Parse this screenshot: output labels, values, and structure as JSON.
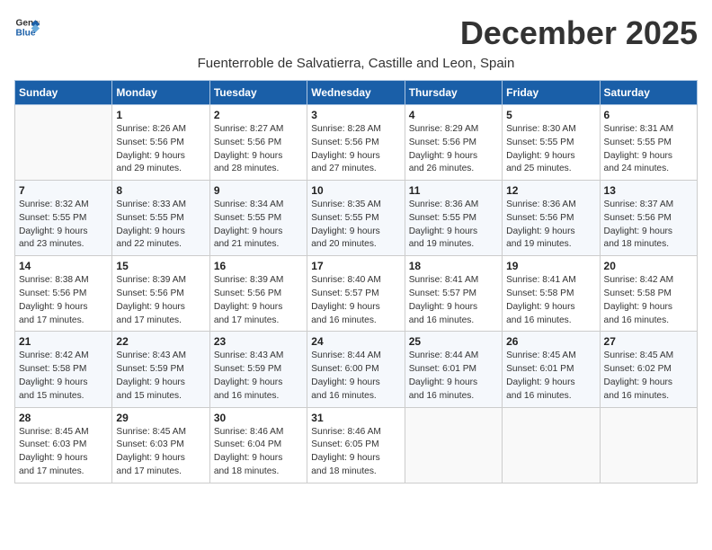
{
  "header": {
    "logo_line1": "General",
    "logo_line2": "Blue",
    "month_title": "December 2025",
    "location": "Fuenterroble de Salvatierra, Castille and Leon, Spain"
  },
  "weekdays": [
    "Sunday",
    "Monday",
    "Tuesday",
    "Wednesday",
    "Thursday",
    "Friday",
    "Saturday"
  ],
  "weeks": [
    [
      {
        "day": "",
        "info": ""
      },
      {
        "day": "1",
        "info": "Sunrise: 8:26 AM\nSunset: 5:56 PM\nDaylight: 9 hours\nand 29 minutes."
      },
      {
        "day": "2",
        "info": "Sunrise: 8:27 AM\nSunset: 5:56 PM\nDaylight: 9 hours\nand 28 minutes."
      },
      {
        "day": "3",
        "info": "Sunrise: 8:28 AM\nSunset: 5:56 PM\nDaylight: 9 hours\nand 27 minutes."
      },
      {
        "day": "4",
        "info": "Sunrise: 8:29 AM\nSunset: 5:56 PM\nDaylight: 9 hours\nand 26 minutes."
      },
      {
        "day": "5",
        "info": "Sunrise: 8:30 AM\nSunset: 5:55 PM\nDaylight: 9 hours\nand 25 minutes."
      },
      {
        "day": "6",
        "info": "Sunrise: 8:31 AM\nSunset: 5:55 PM\nDaylight: 9 hours\nand 24 minutes."
      }
    ],
    [
      {
        "day": "7",
        "info": "Sunrise: 8:32 AM\nSunset: 5:55 PM\nDaylight: 9 hours\nand 23 minutes."
      },
      {
        "day": "8",
        "info": "Sunrise: 8:33 AM\nSunset: 5:55 PM\nDaylight: 9 hours\nand 22 minutes."
      },
      {
        "day": "9",
        "info": "Sunrise: 8:34 AM\nSunset: 5:55 PM\nDaylight: 9 hours\nand 21 minutes."
      },
      {
        "day": "10",
        "info": "Sunrise: 8:35 AM\nSunset: 5:55 PM\nDaylight: 9 hours\nand 20 minutes."
      },
      {
        "day": "11",
        "info": "Sunrise: 8:36 AM\nSunset: 5:55 PM\nDaylight: 9 hours\nand 19 minutes."
      },
      {
        "day": "12",
        "info": "Sunrise: 8:36 AM\nSunset: 5:56 PM\nDaylight: 9 hours\nand 19 minutes."
      },
      {
        "day": "13",
        "info": "Sunrise: 8:37 AM\nSunset: 5:56 PM\nDaylight: 9 hours\nand 18 minutes."
      }
    ],
    [
      {
        "day": "14",
        "info": "Sunrise: 8:38 AM\nSunset: 5:56 PM\nDaylight: 9 hours\nand 17 minutes."
      },
      {
        "day": "15",
        "info": "Sunrise: 8:39 AM\nSunset: 5:56 PM\nDaylight: 9 hours\nand 17 minutes."
      },
      {
        "day": "16",
        "info": "Sunrise: 8:39 AM\nSunset: 5:56 PM\nDaylight: 9 hours\nand 17 minutes."
      },
      {
        "day": "17",
        "info": "Sunrise: 8:40 AM\nSunset: 5:57 PM\nDaylight: 9 hours\nand 16 minutes."
      },
      {
        "day": "18",
        "info": "Sunrise: 8:41 AM\nSunset: 5:57 PM\nDaylight: 9 hours\nand 16 minutes."
      },
      {
        "day": "19",
        "info": "Sunrise: 8:41 AM\nSunset: 5:58 PM\nDaylight: 9 hours\nand 16 minutes."
      },
      {
        "day": "20",
        "info": "Sunrise: 8:42 AM\nSunset: 5:58 PM\nDaylight: 9 hours\nand 16 minutes."
      }
    ],
    [
      {
        "day": "21",
        "info": "Sunrise: 8:42 AM\nSunset: 5:58 PM\nDaylight: 9 hours\nand 15 minutes."
      },
      {
        "day": "22",
        "info": "Sunrise: 8:43 AM\nSunset: 5:59 PM\nDaylight: 9 hours\nand 15 minutes."
      },
      {
        "day": "23",
        "info": "Sunrise: 8:43 AM\nSunset: 5:59 PM\nDaylight: 9 hours\nand 16 minutes."
      },
      {
        "day": "24",
        "info": "Sunrise: 8:44 AM\nSunset: 6:00 PM\nDaylight: 9 hours\nand 16 minutes."
      },
      {
        "day": "25",
        "info": "Sunrise: 8:44 AM\nSunset: 6:01 PM\nDaylight: 9 hours\nand 16 minutes."
      },
      {
        "day": "26",
        "info": "Sunrise: 8:45 AM\nSunset: 6:01 PM\nDaylight: 9 hours\nand 16 minutes."
      },
      {
        "day": "27",
        "info": "Sunrise: 8:45 AM\nSunset: 6:02 PM\nDaylight: 9 hours\nand 16 minutes."
      }
    ],
    [
      {
        "day": "28",
        "info": "Sunrise: 8:45 AM\nSunset: 6:03 PM\nDaylight: 9 hours\nand 17 minutes."
      },
      {
        "day": "29",
        "info": "Sunrise: 8:45 AM\nSunset: 6:03 PM\nDaylight: 9 hours\nand 17 minutes."
      },
      {
        "day": "30",
        "info": "Sunrise: 8:46 AM\nSunset: 6:04 PM\nDaylight: 9 hours\nand 18 minutes."
      },
      {
        "day": "31",
        "info": "Sunrise: 8:46 AM\nSunset: 6:05 PM\nDaylight: 9 hours\nand 18 minutes."
      },
      {
        "day": "",
        "info": ""
      },
      {
        "day": "",
        "info": ""
      },
      {
        "day": "",
        "info": ""
      }
    ]
  ]
}
